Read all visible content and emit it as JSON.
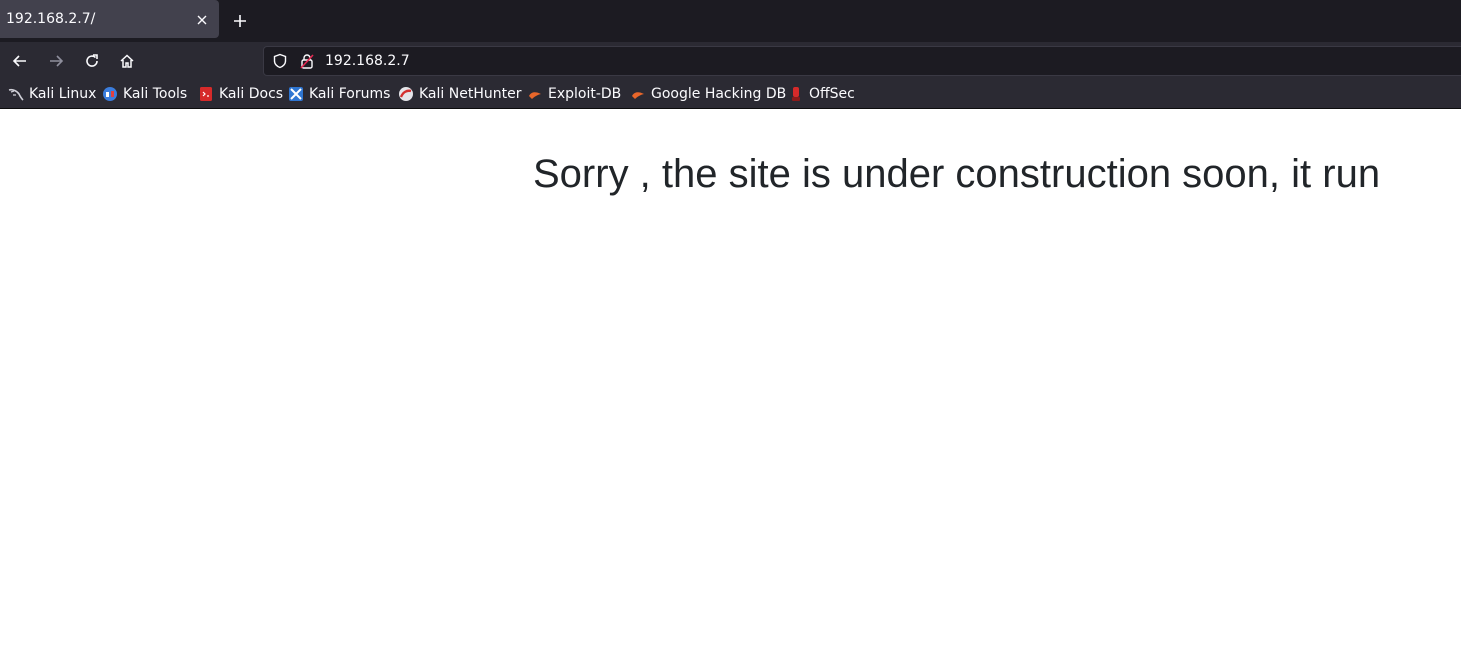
{
  "browser": {
    "tab": {
      "title": "192.168.2.7/",
      "close_icon": "close-icon"
    },
    "new_tab_icon": "plus-icon",
    "nav": {
      "back_icon": "arrow-left-icon",
      "forward_icon": "arrow-right-icon",
      "reload_icon": "reload-icon",
      "home_icon": "home-icon"
    },
    "urlbar": {
      "value": "192.168.2.7",
      "shield_icon": "shield-icon",
      "lock_icon": "insecure-lock-icon"
    },
    "bookmarks": [
      {
        "label": "Kali Linux",
        "icon": "kali-dragon-icon"
      },
      {
        "label": "Kali Tools",
        "icon": "kali-tools-icon"
      },
      {
        "label": "Kali Docs",
        "icon": "kali-docs-icon"
      },
      {
        "label": "Kali Forums",
        "icon": "kali-forums-icon"
      },
      {
        "label": "Kali NetHunter",
        "icon": "kali-nethunter-icon"
      },
      {
        "label": "Exploit-DB",
        "icon": "exploit-db-icon"
      },
      {
        "label": "Google Hacking DB",
        "icon": "ghdb-icon"
      },
      {
        "label": "OffSec",
        "icon": "offsec-icon"
      }
    ]
  },
  "page": {
    "headline": "Sorry , the site is under construction soon, it run"
  },
  "colors": {
    "tabstrip_bg": "#1c1b22",
    "toolbar_bg": "#2b2a33",
    "active_tab_bg": "#42414d",
    "headline_color": "#212529"
  }
}
